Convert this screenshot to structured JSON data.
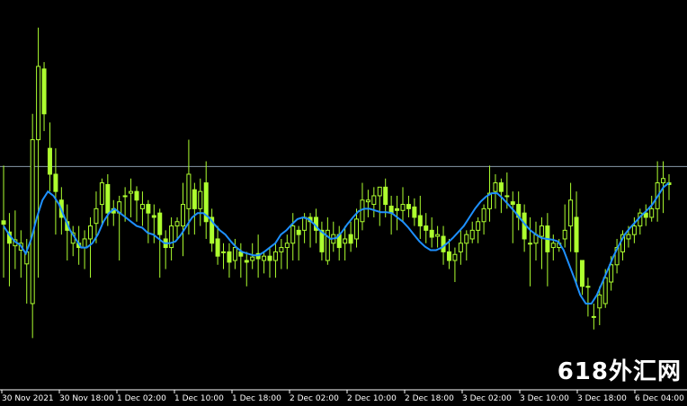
{
  "watermark": "618外汇网",
  "colors": {
    "background": "#000000",
    "candle": "#adff2f",
    "ma_line": "#1e90ff",
    "hline": "#8899aa",
    "axis": "#ffffff"
  },
  "chart_data": {
    "type": "candlestick",
    "title": "",
    "xlabel": "",
    "ylabel": "",
    "ylim": [
      0,
      452
    ],
    "hline_value": 259,
    "x_tick_labels": [
      "30 Nov 2021",
      "30 Nov 18:00",
      "1 Dec 02:00",
      "1 Dec 10:00",
      "1 Dec 18:00",
      "2 Dec 02:00",
      "2 Dec 10:00",
      "2 Dec 18:00",
      "3 Dec 02:00",
      "3 Dec 10:00",
      "3 Dec 18:00",
      "6 Dec 04:00"
    ],
    "candles": [
      [
        196,
        192,
        260,
        130
      ],
      [
        183,
        170,
        205,
        120
      ],
      [
        167,
        174,
        208,
        140
      ],
      [
        162,
        170,
        185,
        130
      ],
      [
        146,
        160,
        175,
        100
      ],
      [
        100,
        290,
        320,
        60
      ],
      [
        290,
        375,
        420,
        130
      ],
      [
        372,
        320,
        380,
        300
      ],
      [
        280,
        250,
        310,
        230
      ],
      [
        250,
        230,
        280,
        180
      ],
      [
        220,
        200,
        235,
        180
      ],
      [
        195,
        185,
        215,
        150
      ],
      [
        170,
        182,
        190,
        155
      ],
      [
        170,
        165,
        190,
        145
      ],
      [
        165,
        175,
        185,
        140
      ],
      [
        175,
        190,
        200,
        130
      ],
      [
        193,
        210,
        230,
        170
      ],
      [
        215,
        240,
        245,
        190
      ],
      [
        238,
        205,
        250,
        190
      ],
      [
        210,
        205,
        220,
        190
      ],
      [
        205,
        218,
        225,
        150
      ],
      [
        225,
        225,
        235,
        195
      ],
      [
        228,
        230,
        245,
        200
      ],
      [
        230,
        220,
        236,
        195
      ],
      [
        210,
        215,
        230,
        190
      ],
      [
        215,
        205,
        220,
        170
      ],
      [
        202,
        200,
        215,
        170
      ],
      [
        205,
        180,
        210,
        130
      ],
      [
        175,
        165,
        185,
        140
      ],
      [
        165,
        190,
        200,
        150
      ],
      [
        190,
        195,
        200,
        175
      ],
      [
        190,
        215,
        240,
        155
      ],
      [
        210,
        250,
        290,
        180
      ],
      [
        232,
        210,
        240,
        180
      ],
      [
        210,
        230,
        245,
        190
      ],
      [
        240,
        195,
        265,
        175
      ],
      [
        200,
        170,
        210,
        160
      ],
      [
        175,
        155,
        190,
        145
      ],
      [
        160,
        160,
        170,
        140
      ],
      [
        160,
        148,
        170,
        130
      ],
      [
        150,
        165,
        175,
        140
      ],
      [
        160,
        155,
        170,
        130
      ],
      [
        150,
        148,
        160,
        120
      ],
      [
        150,
        154,
        170,
        140
      ],
      [
        158,
        152,
        180,
        130
      ],
      [
        150,
        155,
        160,
        135
      ],
      [
        155,
        150,
        165,
        130
      ],
      [
        150,
        160,
        170,
        130
      ],
      [
        160,
        165,
        175,
        140
      ],
      [
        165,
        170,
        180,
        140
      ],
      [
        170,
        190,
        205,
        150
      ],
      [
        185,
        180,
        190,
        150
      ],
      [
        185,
        200,
        205,
        170
      ],
      [
        200,
        195,
        205,
        165
      ],
      [
        200,
        185,
        210,
        170
      ],
      [
        185,
        160,
        195,
        150
      ],
      [
        150,
        185,
        200,
        145
      ],
      [
        170,
        180,
        195,
        160
      ],
      [
        180,
        165,
        190,
        150
      ],
      [
        170,
        175,
        190,
        150
      ],
      [
        180,
        170,
        195,
        160
      ],
      [
        175,
        198,
        210,
        165
      ],
      [
        195,
        220,
        240,
        185
      ],
      [
        218,
        220,
        232,
        200
      ],
      [
        215,
        225,
        235,
        200
      ],
      [
        225,
        235,
        235,
        190
      ],
      [
        235,
        215,
        245,
        200
      ],
      [
        213,
        205,
        225,
        180
      ],
      [
        210,
        208,
        225,
        185
      ],
      [
        208,
        215,
        235,
        195
      ],
      [
        215,
        210,
        225,
        200
      ],
      [
        212,
        200,
        222,
        190
      ],
      [
        202,
        190,
        225,
        175
      ],
      [
        190,
        185,
        205,
        170
      ],
      [
        185,
        177,
        200,
        165
      ],
      [
        178,
        180,
        190,
        165
      ],
      [
        178,
        160,
        190,
        145
      ],
      [
        160,
        150,
        175,
        140
      ],
      [
        150,
        157,
        165,
        125
      ],
      [
        160,
        170,
        185,
        145
      ],
      [
        170,
        180,
        185,
        150
      ],
      [
        175,
        185,
        195,
        170
      ],
      [
        185,
        195,
        200,
        170
      ],
      [
        195,
        210,
        215,
        180
      ],
      [
        210,
        228,
        260,
        195
      ],
      [
        230,
        240,
        250,
        210
      ],
      [
        240,
        230,
        245,
        205
      ],
      [
        225,
        225,
        252,
        210
      ],
      [
        218,
        215,
        230,
        170
      ],
      [
        215,
        200,
        230,
        185
      ],
      [
        205,
        175,
        215,
        160
      ],
      [
        170,
        170,
        200,
        120
      ],
      [
        170,
        180,
        195,
        150
      ],
      [
        178,
        190,
        200,
        140
      ],
      [
        190,
        160,
        205,
        120
      ],
      [
        165,
        170,
        180,
        150
      ],
      [
        165,
        170,
        175,
        160
      ],
      [
        175,
        185,
        215,
        165
      ],
      [
        190,
        220,
        240,
        160
      ],
      [
        200,
        160,
        230,
        120
      ],
      [
        150,
        120,
        150,
        110
      ],
      [
        120,
        120,
        130,
        85
      ],
      [
        85,
        85,
        100,
        70
      ],
      [
        95,
        110,
        120,
        75
      ],
      [
        100,
        130,
        140,
        95
      ],
      [
        125,
        145,
        155,
        115
      ],
      [
        145,
        165,
        175,
        135
      ],
      [
        160,
        180,
        185,
        150
      ],
      [
        175,
        180,
        190,
        165
      ],
      [
        180,
        190,
        200,
        170
      ],
      [
        190,
        205,
        210,
        180
      ],
      [
        205,
        200,
        215,
        190
      ],
      [
        200,
        210,
        225,
        195
      ],
      [
        210,
        240,
        265,
        195
      ],
      [
        240,
        245,
        265,
        205
      ],
      [
        240,
        238,
        250,
        220
      ]
    ],
    "ma_line": [
      190,
      180,
      172,
      168,
      158,
      175,
      200,
      220,
      230,
      225,
      215,
      200,
      185,
      175,
      165,
      165,
      170,
      180,
      195,
      205,
      210,
      205,
      200,
      195,
      190,
      188,
      182,
      180,
      175,
      170,
      170,
      172,
      180,
      190,
      200,
      205,
      205,
      200,
      192,
      185,
      180,
      172,
      165,
      160,
      158,
      156,
      156,
      160,
      165,
      170,
      180,
      185,
      192,
      198,
      200,
      198,
      192,
      185,
      180,
      175,
      176,
      183,
      192,
      200,
      207,
      210,
      210,
      208,
      206,
      206,
      205,
      200,
      195,
      188,
      180,
      172,
      166,
      162,
      162,
      165,
      170,
      176,
      183,
      190,
      200,
      210,
      218,
      224,
      228,
      228,
      222,
      215,
      208,
      200,
      192,
      185,
      180,
      176,
      175,
      174,
      172,
      162,
      145,
      128,
      110,
      100,
      100,
      110,
      125,
      140,
      155,
      168,
      180,
      188,
      195,
      202,
      208,
      215,
      225,
      235,
      240
    ]
  }
}
